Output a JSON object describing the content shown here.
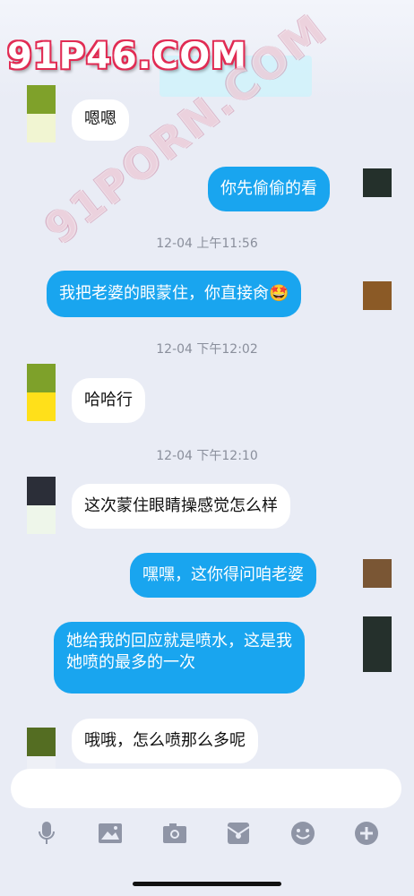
{
  "watermarks": {
    "top": "91P46.COM",
    "diagonal": "91PORN.COM"
  },
  "messages": [
    {
      "side": "in",
      "text": "嗯嗯",
      "avatar": [
        "#7fa12a",
        "#f1f5d2"
      ]
    },
    {
      "side": "out",
      "text": "你先偷偷的看",
      "avatar": [
        "#24302b"
      ]
    },
    {
      "timestamp": "12-04 上午11:56"
    },
    {
      "side": "out",
      "text": "我把老婆的眼蒙住，你直接肏",
      "emoji": "🤩",
      "avatar": [
        "#8b5a26"
      ]
    },
    {
      "timestamp": "12-04 下午12:02"
    },
    {
      "side": "in",
      "text": "哈哈行",
      "avatar": [
        "#7ea12a",
        "#ffe01a"
      ]
    },
    {
      "timestamp": "12-04 下午12:10"
    },
    {
      "side": "in",
      "text": "这次蒙住眼睛操感觉怎么样",
      "avatar": [
        "#2b2e38",
        "#eef6ea"
      ]
    },
    {
      "side": "out",
      "text": "嘿嘿，这你得问咱老婆",
      "avatar": [
        "#7a5634"
      ]
    },
    {
      "side": "out",
      "text_lines": [
        "她给我的回应就是喷水，这是我",
        "她喷的最多的一次"
      ],
      "avatar": [
        "#25302c"
      ]
    },
    {
      "side": "in",
      "text": "哦哦，怎么喷那么多呢",
      "avatar": [
        "#546d22"
      ]
    }
  ],
  "toolbar": {
    "icons": [
      "microphone-icon",
      "image-icon",
      "camera-icon",
      "red-packet-icon",
      "emoji-icon",
      "plus-icon"
    ]
  },
  "colors": {
    "outgoing_bubble": "#19a5ef",
    "incoming_bubble": "#ffffff",
    "background": "#e9ecf5",
    "icon_gray": "#8f95a6"
  }
}
